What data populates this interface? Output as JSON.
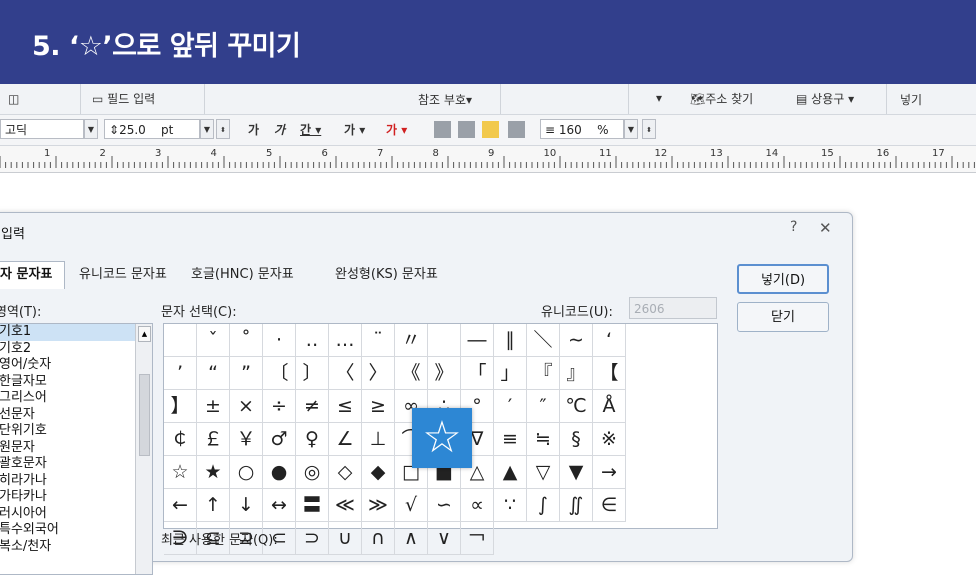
{
  "banner": {
    "title": "5. ‘☆’으로 앞뒤 꾸미기",
    "color": "#323f8c"
  },
  "ribbon": {
    "field_input": "필드 입력",
    "ref_symbol_1": "참조",
    "ref_symbol_2": "부호▾",
    "chartable_arrow": "▾",
    "address": "주소 찾기",
    "phrases": "상용구 ▾",
    "insert": "넣기"
  },
  "format_bar": {
    "font": "고딕",
    "size": "25.0",
    "unit": "pt",
    "bold": "가",
    "italic": "가",
    "underline": "간 ▾",
    "strike": "가 ▾",
    "color": "가 ▾",
    "line_spacing": "160",
    "percent": "%"
  },
  "ruler": {
    "numbers": [
      "1",
      "2",
      "3",
      "4",
      "5",
      "6",
      "7",
      "8",
      "9",
      "10",
      "11",
      "12",
      "13",
      "14",
      "15",
      "16",
      "17"
    ]
  },
  "dialog": {
    "title": "입력",
    "help_icon": "?",
    "close_icon": "✕",
    "tabs": [
      "자 문자표",
      "유니코드 문자표",
      "호글(HNC) 문자표",
      "완성형(KS) 문자표"
    ],
    "area_label": "영역(T):",
    "select_label": "문자 선택(C):",
    "unicode_label": "유니코드(U):",
    "unicode_value": "2606",
    "categories": [
      "기호1",
      "기호2",
      "영어/숫자",
      "한글자모",
      "그리스어",
      "선문자",
      "단위기호",
      "원문자",
      "괄호문자",
      "히라가나",
      "가타카나",
      "러시아어",
      "특수외국어",
      "복소/천자"
    ],
    "symbols": [
      "",
      "ˇ",
      "˚",
      "·",
      "‥",
      "…",
      "¨",
      "〃",
      "­",
      "―",
      "∥",
      "＼",
      "∼",
      "‘",
      "’",
      "“",
      "”",
      "〔",
      "〕",
      "〈",
      "〉",
      "《",
      "》",
      "「",
      "」",
      "『",
      "』",
      "【",
      "】",
      "±",
      "×",
      "÷",
      "≠",
      "≤",
      "≥",
      "∞",
      "∴",
      "°",
      "′",
      "″",
      "℃",
      "Å",
      "￠",
      "￡",
      "￥",
      "♂",
      "♀",
      "∠",
      "⊥",
      "⌒",
      "∂",
      "∇",
      "≡",
      "≒",
      "§",
      "※",
      "☆",
      "★",
      "○",
      "●",
      "◎",
      "◇",
      "◆",
      "□",
      "■",
      "△",
      "▲",
      "▽",
      "▼",
      "→",
      "←",
      "↑",
      "↓",
      "↔",
      "〓",
      "≪",
      "≫",
      "√",
      "∽",
      "∝",
      "∵",
      "∫",
      "∬",
      "∈",
      "∋",
      "⊆",
      "⊇",
      "⊂",
      "⊃",
      "∪",
      "∩",
      "∧",
      "∨",
      "￢"
    ],
    "insert_button": "넣기(D)",
    "close_button": "닫기",
    "recent_label": "최근 사용한 문자(Q):",
    "star_popup": "☆"
  }
}
